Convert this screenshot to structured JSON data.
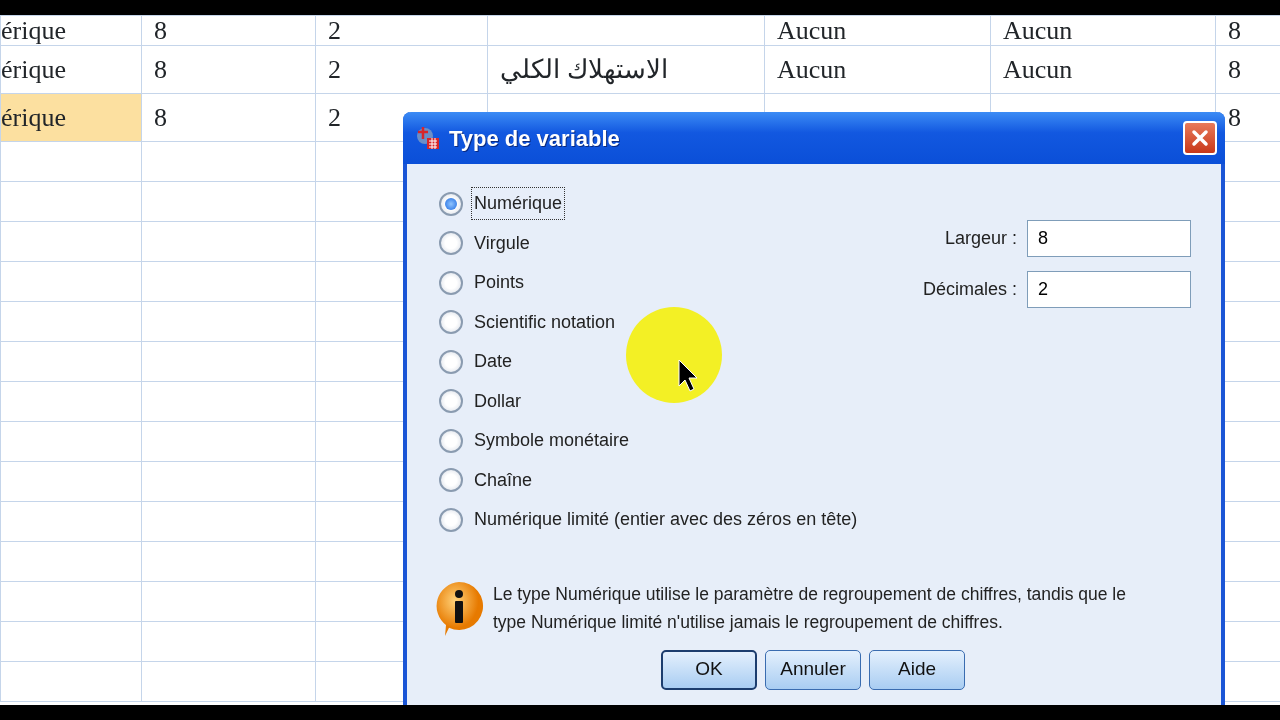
{
  "grid": {
    "rows": [
      {
        "selected": false,
        "cells": [
          "érique",
          "8",
          "2",
          "",
          "Aucun",
          "Aucun",
          "8"
        ]
      },
      {
        "selected": false,
        "cells": [
          "érique",
          "8",
          "2",
          "الاستهلاك الكلي",
          "Aucun",
          "Aucun",
          "8"
        ]
      },
      {
        "selected": true,
        "cells": [
          "érique",
          "8",
          "2",
          "",
          "",
          "",
          "8"
        ]
      }
    ]
  },
  "dialog": {
    "title": "Type de variable",
    "types": [
      {
        "label": "Numérique",
        "selected": true,
        "focused": true
      },
      {
        "label": "Virgule",
        "selected": false,
        "focused": false
      },
      {
        "label": "Points",
        "selected": false,
        "focused": false
      },
      {
        "label": "Scientific notation",
        "selected": false,
        "focused": false
      },
      {
        "label": "Date",
        "selected": false,
        "focused": false
      },
      {
        "label": "Dollar",
        "selected": false,
        "focused": false
      },
      {
        "label": "Symbole monétaire",
        "selected": false,
        "focused": false
      },
      {
        "label": "Chaîne",
        "selected": false,
        "focused": false
      },
      {
        "label": "Numérique limité (entier avec des zéros en tête)",
        "selected": false,
        "focused": false
      }
    ],
    "fields": [
      {
        "label": "Largeur :",
        "value": "8"
      },
      {
        "label": "Décimales :",
        "value": "2"
      }
    ],
    "info": "Le type Numérique utilise le paramètre de regroupement de chiffres, tandis que le type Numérique limité n'utilise jamais le regroupement de chiffres.",
    "buttons": [
      {
        "label": "OK",
        "default": true
      },
      {
        "label": "Annuler",
        "default": false
      },
      {
        "label": "Aide",
        "default": false
      }
    ]
  }
}
